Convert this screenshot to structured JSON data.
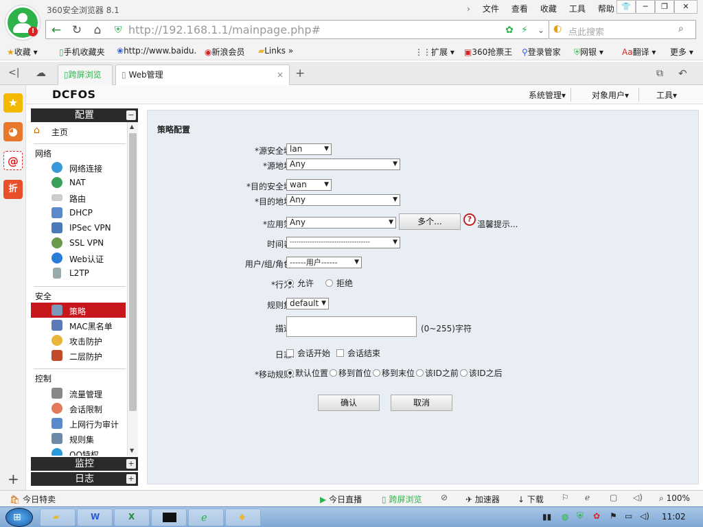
{
  "browser": {
    "app_title": "360安全浏览器 8.1",
    "menus": [
      "文件",
      "查看",
      "收藏",
      "工具",
      "帮助"
    ],
    "url_host": "http://192.168.1.1",
    "url_path": "/mainpage.php#",
    "search_placeholder": "点此搜索",
    "bookmarks": [
      "收藏",
      "手机收藏夹",
      "http://www.baidu.",
      "新浪会员",
      "Links"
    ],
    "bookmarks_right": [
      "扩展",
      "360抢票王",
      "登录管家",
      "网银",
      "翻译",
      "更多"
    ],
    "tabs": [
      "跨屏浏览",
      "Web管理"
    ]
  },
  "app": {
    "brand": "DCFOS",
    "top_menus": [
      "系统管理▾",
      "对象用户▾",
      "工具▾"
    ],
    "panels": {
      "config": "配置",
      "monitor": "监控",
      "log": "日志"
    },
    "home": "主页",
    "sections": {
      "network": "网络",
      "network_items": [
        "网络连接",
        "NAT",
        "路由",
        "DHCP",
        "IPSec VPN",
        "SSL VPN",
        "Web认证",
        "L2TP"
      ],
      "security": "安全",
      "security_items": [
        "策略",
        "MAC黑名单",
        "攻击防护",
        "二层防护"
      ],
      "control": "控制",
      "control_items": [
        "流量管理",
        "会话限制",
        "上网行为审计",
        "规则集",
        "QQ特权"
      ]
    }
  },
  "form": {
    "title": "策略配置",
    "src_zone_label": "*源安全域:",
    "src_zone": "lan",
    "src_addr_label": "*源地址:",
    "src_addr": "Any",
    "dst_zone_label": "*目的安全域:",
    "dst_zone": "wan",
    "dst_addr_label": "*目的地址:",
    "dst_addr": "Any",
    "app_label": "*应用簿:",
    "app": "Any",
    "more_btn": "多个...",
    "tip": "温馨提示...",
    "schedule_label": "时间表:",
    "schedule": "------------------------------------",
    "user_label": "用户/组/角色:",
    "user": "------用户------",
    "action_label": "*行为:",
    "allow": "允许",
    "deny": "拒绝",
    "ruleset_label": "规则集:",
    "ruleset": "default",
    "desc_label": "描述:",
    "desc_hint": "(0~255)字符",
    "log_label": "日志:",
    "log_start": "会话开始",
    "log_end": "会话结束",
    "move_label": "*移动规则:",
    "move_opts": [
      "默认位置",
      "移到首位",
      "移到末位",
      "该ID之前",
      "该ID之后"
    ],
    "ok": "确认",
    "cancel": "取消"
  },
  "statusbar": {
    "left": "今日特卖",
    "items": [
      "今日直播",
      "跨屏浏览",
      "加速器",
      "下载"
    ],
    "zoom": "100%"
  },
  "taskbar": {
    "clock": "11:02"
  },
  "colors": {
    "active_nav": "#c8161d",
    "brand_green": "#2db34a",
    "taskbar": "#7ea7d4"
  }
}
